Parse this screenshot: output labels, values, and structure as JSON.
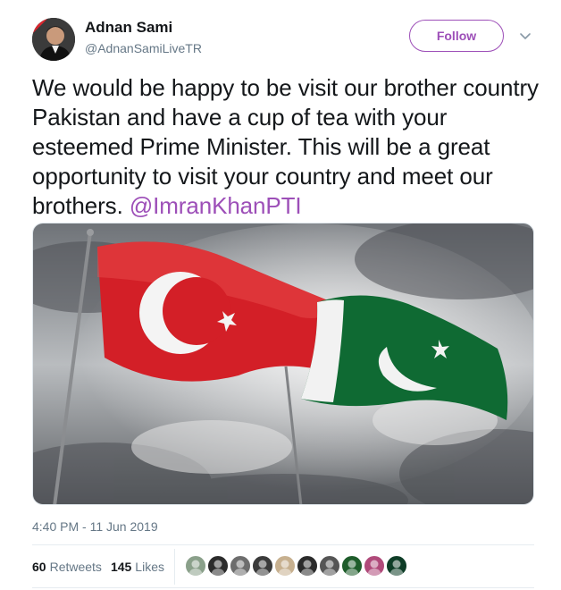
{
  "author": {
    "display_name": "Adnan Sami",
    "handle": "@AdnanSamiLiveTR",
    "avatar_icon": "profile-photo"
  },
  "follow": {
    "label": "Follow",
    "color": "#9d4fb8"
  },
  "menu": {
    "icon": "chevron-down-icon"
  },
  "tweet": {
    "text": "We would be happy to be visit our brother country Pakistan and have a cup of tea with your esteemed Prime Minister. This will be a great opportunity to visit your country and meet our brothers. ",
    "mention": "@ImranKhanPTI",
    "mention_color": "#9d4fb8"
  },
  "media": {
    "image": "turkey-and-pakistan-flags-photo"
  },
  "timestamp": "4:40 PM - 11 Jun 2019",
  "stats": {
    "retweets_count": "60",
    "retweets_label": "Retweets",
    "likes_count": "145",
    "likes_label": "Likes"
  },
  "likers": [
    "#8aa08a",
    "#2b2b2b",
    "#6d6d6d",
    "#3a3a3a",
    "#c7b08f",
    "#2a2a2a",
    "#555555",
    "#1e5c2a",
    "#b04a7a",
    "#0e3d27"
  ]
}
